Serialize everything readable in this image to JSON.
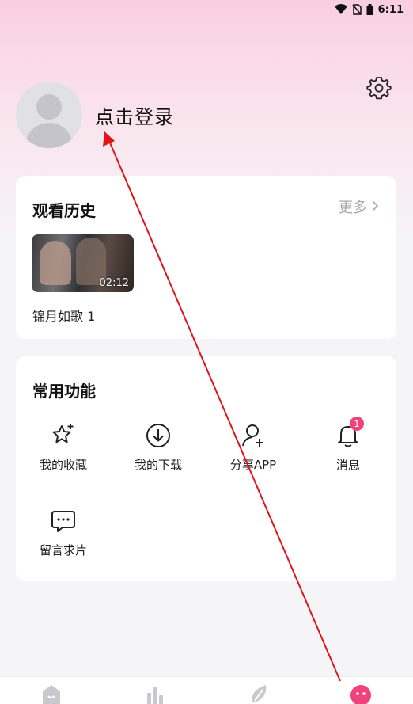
{
  "status_bar": {
    "time": "6:11",
    "icons": [
      "wifi-icon",
      "no-sim-icon",
      "battery-icon"
    ]
  },
  "profile": {
    "login_text": "点击登录",
    "avatar_icon": "avatar-placeholder-icon"
  },
  "settings": {
    "icon": "gear-icon"
  },
  "history": {
    "title": "观看历史",
    "more_label": "更多",
    "items": [
      {
        "title": "锦月如歌 1",
        "duration": "02:12"
      }
    ]
  },
  "features": {
    "title": "常用功能",
    "items": [
      {
        "label": "我的收藏",
        "icon": "star-plus-icon"
      },
      {
        "label": "我的下载",
        "icon": "download-icon"
      },
      {
        "label": "分享APP",
        "icon": "add-user-icon"
      },
      {
        "label": "消息",
        "icon": "bell-icon",
        "badge": "1"
      },
      {
        "label": "留言求片",
        "icon": "message-icon"
      }
    ]
  },
  "tabbar": {
    "items": [
      "home-icon",
      "ranking-icon",
      "discover-icon",
      "mine-icon"
    ]
  },
  "colors": {
    "accent": "#f0437e",
    "annotation": "#e0141c"
  }
}
